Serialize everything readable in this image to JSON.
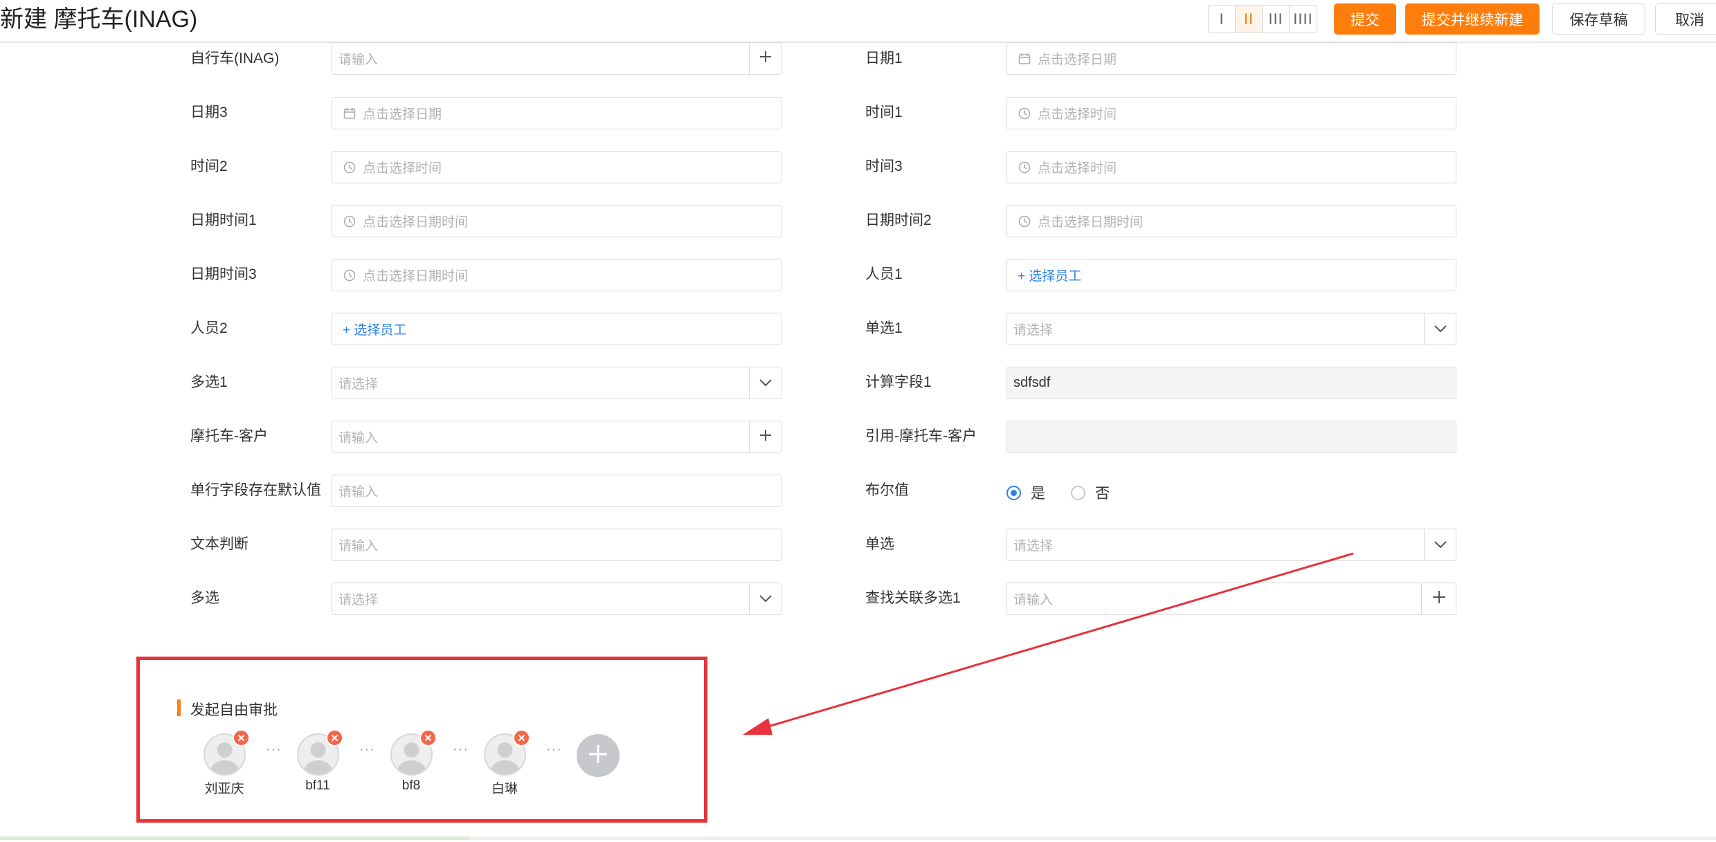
{
  "header": {
    "title": "新建 摩托车(INAG)",
    "column_options": [
      "I",
      "II",
      "III",
      "IIII"
    ],
    "active_column": "II",
    "buttons": {
      "submit": "提交",
      "submit_and_new": "提交并继续新建",
      "save_draft": "保存草稿",
      "cancel": "取消"
    }
  },
  "form": {
    "left": [
      {
        "label": "自行车(INAG)",
        "placeholder": "请输入",
        "kind": "lookup"
      },
      {
        "label": "日期3",
        "placeholder": "点击选择日期",
        "kind": "date"
      },
      {
        "label": "时间2",
        "placeholder": "点击选择时间",
        "kind": "time"
      },
      {
        "label": "日期时间1",
        "placeholder": "点击选择日期时间",
        "kind": "datetime"
      },
      {
        "label": "日期时间3",
        "placeholder": "点击选择日期时间",
        "kind": "datetime"
      },
      {
        "label": "人员2",
        "link": "+ 选择员工",
        "kind": "employee"
      },
      {
        "label": "多选1",
        "placeholder": "请选择",
        "kind": "select"
      },
      {
        "label": "摩托车-客户",
        "placeholder": "请输入",
        "kind": "lookup"
      },
      {
        "label": "单行字段存在默认值",
        "placeholder": "请输入",
        "kind": "text"
      },
      {
        "label": "文本判断",
        "placeholder": "请输入",
        "kind": "text"
      },
      {
        "label": "多选",
        "placeholder": "请选择",
        "kind": "select"
      }
    ],
    "right": [
      {
        "label": "日期1",
        "placeholder": "点击选择日期",
        "kind": "date"
      },
      {
        "label": "时间1",
        "placeholder": "点击选择时间",
        "kind": "time"
      },
      {
        "label": "时间3",
        "placeholder": "点击选择时间",
        "kind": "time"
      },
      {
        "label": "日期时间2",
        "placeholder": "点击选择日期时间",
        "kind": "datetime"
      },
      {
        "label": "人员1",
        "link": "+ 选择员工",
        "kind": "employee"
      },
      {
        "label": "单选1",
        "placeholder": "请选择",
        "kind": "select"
      },
      {
        "label": "计算字段1",
        "value": "sdfsdf",
        "kind": "readonly"
      },
      {
        "label": "引用-摩托车-客户",
        "value": "",
        "kind": "readonly"
      },
      {
        "label": "布尔值",
        "kind": "radio",
        "options": [
          "是",
          "否"
        ],
        "selected": "是"
      },
      {
        "label": "单选",
        "placeholder": "请选择",
        "kind": "select"
      },
      {
        "label": "查找关联多选1",
        "placeholder": "请输入",
        "kind": "lookup"
      }
    ]
  },
  "approval": {
    "title": "发起自由审批",
    "approvers": [
      "刘亚庆",
      "bf11",
      "bf8",
      "白琳"
    ],
    "separator": "···"
  },
  "colors": {
    "accent": "#ff7d0d",
    "link": "#2f80ed",
    "highlight": "#e8323c",
    "remove_badge": "#f4664a"
  }
}
